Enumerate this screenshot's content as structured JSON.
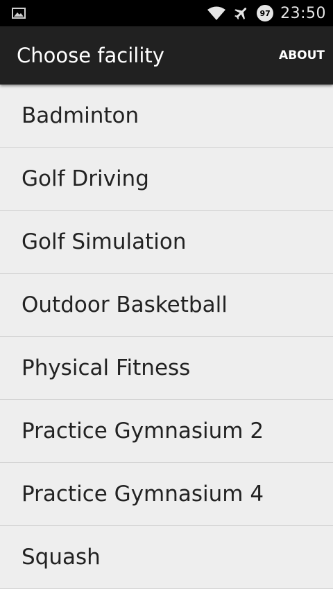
{
  "status_bar": {
    "time": "23:50",
    "battery_level": "97",
    "icons": [
      "gallery-notification-icon",
      "wifi-icon",
      "airplane-mode-icon",
      "battery-icon"
    ]
  },
  "action_bar": {
    "title": "Choose facility",
    "about_label": "ABOUT"
  },
  "facilities": [
    "Badminton",
    "Golf Driving",
    "Golf Simulation",
    "Outdoor Basketball",
    "Physical Fitness",
    "Practice Gymnasium 2",
    "Practice Gymnasium 4",
    "Squash"
  ],
  "colors": {
    "status_bar_bg": "#000000",
    "action_bar_bg": "#212121",
    "list_bg": "#eeeeee",
    "divider": "#d4d4d4",
    "text": "#222222"
  }
}
